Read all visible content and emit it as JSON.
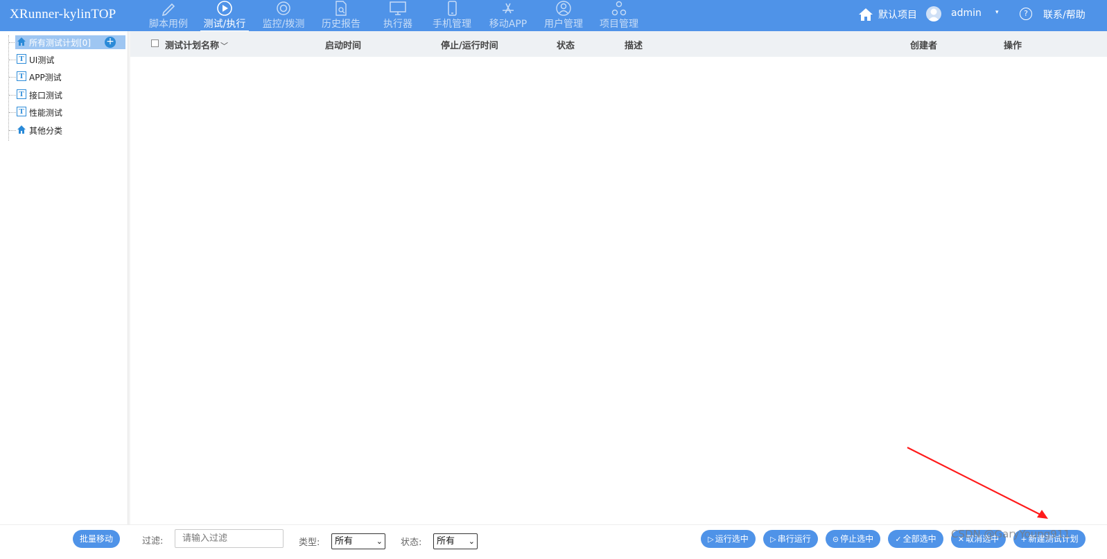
{
  "app": {
    "title": "XRunner-kylinTOP"
  },
  "nav": [
    {
      "label": "脚本用例",
      "icon": "pencil-icon",
      "active": false
    },
    {
      "label": "测试/执行",
      "icon": "play-icon",
      "active": true
    },
    {
      "label": "监控/拨测",
      "icon": "monitor-dial-icon",
      "active": false
    },
    {
      "label": "历史报告",
      "icon": "report-search-icon",
      "active": false
    },
    {
      "label": "执行器",
      "icon": "desktop-icon",
      "active": false
    },
    {
      "label": "手机管理",
      "icon": "phone-icon",
      "active": false
    },
    {
      "label": "移动APP",
      "icon": "app-store-icon",
      "active": false
    },
    {
      "label": "用户管理",
      "icon": "user-icon",
      "active": false
    },
    {
      "label": "项目管理",
      "icon": "project-nodes-icon",
      "active": false
    }
  ],
  "header_right": {
    "project": "默认项目",
    "user": "admin",
    "caret": "▾",
    "help_symbol": "?",
    "help": "联系/帮助"
  },
  "tree": {
    "add_symbol": "+",
    "items": [
      {
        "label": "所有测试计划[0]",
        "icon": "home-icon",
        "selected": true
      },
      {
        "label": "UI测试",
        "icon": "t-box-icon",
        "selected": false
      },
      {
        "label": "APP测试",
        "icon": "t-box-icon",
        "selected": false
      },
      {
        "label": "接口测试",
        "icon": "t-box-icon",
        "selected": false
      },
      {
        "label": "性能测试",
        "icon": "t-box-icon",
        "selected": false
      },
      {
        "label": "其他分类",
        "icon": "home-icon",
        "selected": false
      }
    ],
    "t_glyph": "T"
  },
  "table": {
    "columns": [
      "测试计划名称",
      "启动时间",
      "停止/运行时间",
      "状态",
      "描述",
      "创建者",
      "操作"
    ],
    "sort_glyph": "﹀",
    "rows": []
  },
  "bottom": {
    "batch_move": "批量移动",
    "filter_label": "过滤:",
    "filter_placeholder": "请输入过滤",
    "type_label": "类型:",
    "type_value": "所有",
    "status_label": "状态:",
    "status_value": "所有",
    "select_chevron": "⌄",
    "buttons": [
      {
        "label": "运行选中",
        "icon": "▷"
      },
      {
        "label": "串行运行",
        "icon": "▷"
      },
      {
        "label": "停止选中",
        "icon": "⊝"
      },
      {
        "label": "全部选中",
        "icon": "✓"
      },
      {
        "label": "取消选中",
        "icon": "✕"
      },
      {
        "label": "新建测试计划",
        "icon": "+"
      }
    ]
  },
  "watermark": "CSDN @GaryYoung911",
  "colors": {
    "header": "#4f93e8",
    "accent": "#2a8ad8",
    "selected": "#9ec6f2",
    "arrow": "#ff1a1a"
  }
}
